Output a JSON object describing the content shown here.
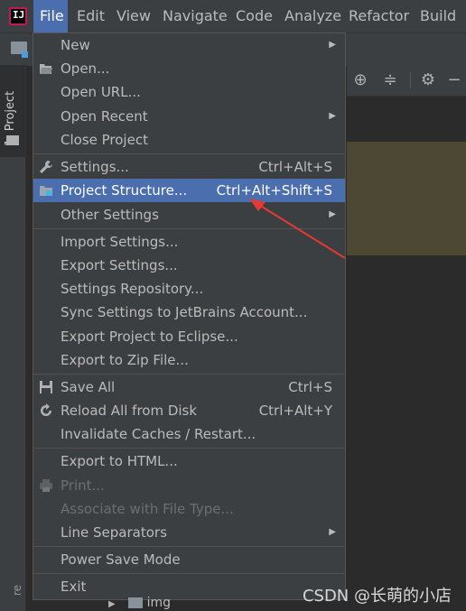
{
  "menubar": {
    "items": [
      "File",
      "Edit",
      "View",
      "Navigate",
      "Code",
      "Analyze",
      "Refactor",
      "Build"
    ]
  },
  "leftstrip": {
    "project_tab": "1: Project",
    "bottom_label": "re"
  },
  "file_menu": {
    "new": "New",
    "open": "Open...",
    "open_url": "Open URL...",
    "open_recent": "Open Recent",
    "close_project": "Close Project",
    "settings": "Settings...",
    "settings_sc": "Ctrl+Alt+S",
    "project_structure": "Project Structure...",
    "project_structure_sc": "Ctrl+Alt+Shift+S",
    "other_settings": "Other Settings",
    "import_settings": "Import Settings...",
    "export_settings": "Export Settings...",
    "settings_repo": "Settings Repository...",
    "sync_settings": "Sync Settings to JetBrains Account...",
    "export_eclipse": "Export Project to Eclipse...",
    "export_zip": "Export to Zip File...",
    "save_all": "Save All",
    "save_all_sc": "Ctrl+S",
    "reload": "Reload All from Disk",
    "reload_sc": "Ctrl+Alt+Y",
    "invalidate": "Invalidate Caches / Restart...",
    "export_html": "Export to HTML...",
    "print": "Print...",
    "associate": "Associate with File Type...",
    "line_sep": "Line Separators",
    "power_save": "Power Save Mode",
    "exit": "Exit"
  },
  "tree": {
    "folder": "img"
  },
  "watermark": "CSDN @长萌的小店",
  "colors": {
    "selection": "#4b6eaf",
    "arrow": "#e53935"
  }
}
